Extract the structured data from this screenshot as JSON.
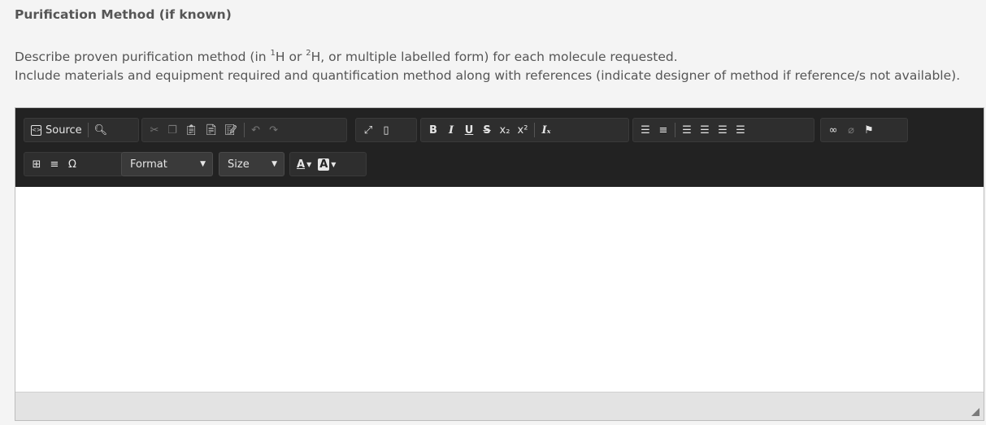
{
  "field": {
    "title": "Purification Method (if known)",
    "desc_line1_part1": "Describe proven purification method (in ",
    "desc_sup1": "1",
    "desc_line1_part2": "H or ",
    "desc_sup2": "2",
    "desc_line1_part3": "H, or multiple labelled form) for each molecule requested.",
    "desc_line2": "Include materials and equipment required and quantification method along with references (indicate designer of method if reference/s not available)."
  },
  "toolbar": {
    "source_label": "Source",
    "format_label": "Format",
    "size_label": "Size",
    "font_color_label": "A",
    "bg_color_label": "A"
  },
  "editor": {
    "content": ""
  }
}
